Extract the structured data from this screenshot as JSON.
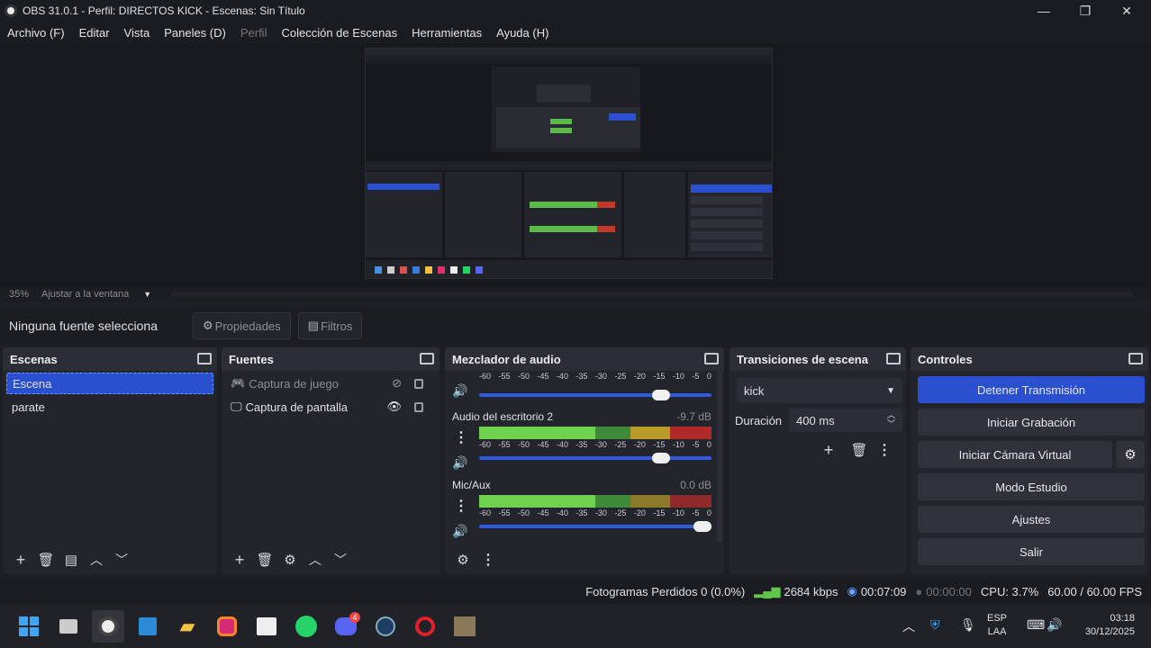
{
  "window": {
    "title": "OBS 31.0.1 - Perfil: DIRECTOS KICK - Escenas: Sin Título",
    "minimize_glyph": "—",
    "maximize_glyph": "❐",
    "close_glyph": "✕"
  },
  "menu": [
    "Archivo (F)",
    "Editar",
    "Vista",
    "Paneles (D)",
    "Perfil",
    "Colección de Escenas",
    "Herramientas",
    "Ayuda (H)"
  ],
  "zoom": {
    "value": "35%",
    "mode": "Ajustar a la ventana"
  },
  "source_toolbar": {
    "no_source": "Ninguna fuente selecciona",
    "properties": "Propiedades",
    "filters": "Filtros"
  },
  "scenes": {
    "title": "Escenas",
    "items": [
      {
        "name": "Escena",
        "selected": true
      },
      {
        "name": "parate",
        "selected": false
      }
    ]
  },
  "sources": {
    "title": "Fuentes",
    "items": [
      {
        "name": "Captura de juego",
        "visible": false
      },
      {
        "name": "Captura de pantalla",
        "visible": true
      }
    ]
  },
  "mixer": {
    "title": "Mezclador de audio",
    "scale": [
      "-60",
      "-55",
      "-50",
      "-45",
      "-40",
      "-35",
      "-30",
      "-25",
      "-20",
      "-15",
      "-10",
      "-5",
      "0"
    ],
    "channels": [
      {
        "name": "",
        "db": "",
        "volume": 0.82
      },
      {
        "name": "Audio del escritorio 2",
        "db": "-9.7 dB",
        "volume": 0.82
      },
      {
        "name": "Mic/Aux",
        "db": "0.0 dB",
        "volume": 1.0
      }
    ]
  },
  "transitions": {
    "title": "Transiciones de escena",
    "selected": "kick",
    "duration_label": "Duración",
    "duration_value": "400 ms"
  },
  "controls": {
    "title": "Controles",
    "buttons": [
      "Detener Transmisión",
      "Iniciar Grabación",
      "Iniciar Cámara Virtual",
      "Modo Estudio",
      "Ajustes",
      "Salir"
    ]
  },
  "status": {
    "dropped": "Fotogramas Perdidos 0 (0.0%)",
    "bitrate": "2684 kbps",
    "stream_time": "00:07:09",
    "rec_time": "00:00:00",
    "cpu": "CPU: 3.7%",
    "fps": "60.00 / 60.00 FPS"
  },
  "taskbar": {
    "lang": "ESP",
    "lang2": "LAA",
    "time": "03:18",
    "date": "30/12/2025",
    "discord_badge": "4"
  },
  "colors": {
    "accent": "#2a4fcf",
    "meter_green": "#6fbf4f",
    "meter_yellow": "#c9b43a",
    "meter_red": "#c0392b"
  }
}
